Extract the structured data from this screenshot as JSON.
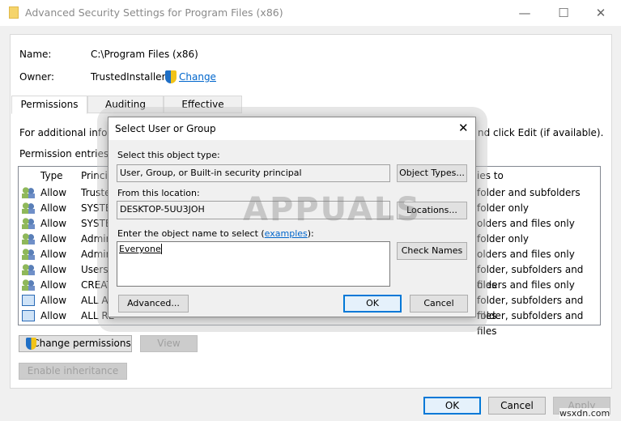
{
  "window": {
    "title": "Advanced Security Settings for Program Files (x86)",
    "minimize": "—",
    "maximize": "☐",
    "close": "✕"
  },
  "info": {
    "name_label": "Name:",
    "name_value": "C:\\Program Files (x86)",
    "owner_label": "Owner:",
    "owner_value": "TrustedInstaller",
    "change_link": "Change"
  },
  "tabs": [
    {
      "label": "Permissions",
      "active": true
    },
    {
      "label": "Auditing"
    },
    {
      "label": "Effective Access"
    }
  ],
  "permissions": {
    "info_text_left": "For additional inform",
    "info_text_right": "nd click Edit (if available).",
    "entries_label": "Permission entries:",
    "columns": {
      "type": "Type",
      "principal": "Princip",
      "applies": "ies to"
    },
    "rows": [
      {
        "icon": "users-icon",
        "type": "Allow",
        "principal": "Truste",
        "applies": "folder and subfolders"
      },
      {
        "icon": "users-icon",
        "type": "Allow",
        "principal": "SYSTE",
        "applies": "folder only"
      },
      {
        "icon": "users-icon",
        "type": "Allow",
        "principal": "SYSTE",
        "applies": "olders and files only"
      },
      {
        "icon": "users-icon",
        "type": "Allow",
        "principal": "Admir",
        "applies": "folder only"
      },
      {
        "icon": "users-icon",
        "type": "Allow",
        "principal": "Admir",
        "applies": "olders and files only"
      },
      {
        "icon": "users-icon",
        "type": "Allow",
        "principal": "Users (",
        "applies": "folder, subfolders and files"
      },
      {
        "icon": "users-icon",
        "type": "Allow",
        "principal": "CREAT",
        "applies": "olders and files only"
      },
      {
        "icon": "app-package-icon",
        "type": "Allow",
        "principal": "ALL Al",
        "applies": "folder, subfolders and files"
      },
      {
        "icon": "app-package-icon",
        "type": "Allow",
        "principal": "ALL RE",
        "applies": "folder, subfolders and files"
      }
    ],
    "change_permissions": "Change permissions",
    "view": "View",
    "enable_inheritance": "Enable inheritance"
  },
  "footer": {
    "ok": "OK",
    "cancel": "Cancel",
    "apply": "Apply"
  },
  "dialog": {
    "title": "Select User or Group",
    "close": "✕",
    "object_type_label": "Select this object type:",
    "object_type_value": "User, Group, or Built-in security principal",
    "object_types_button": "Object Types...",
    "location_label": "From this location:",
    "location_value": "DESKTOP-5UU3JOH",
    "locations_button": "Locations...",
    "name_label_prefix": "Enter the object name to select (",
    "name_label_link": "examples",
    "name_label_suffix": "):",
    "name_value": "Everyone",
    "check_names_button": "Check Names",
    "advanced_button": "Advanced...",
    "ok": "OK",
    "cancel": "Cancel"
  },
  "watermark": {
    "logo": "APPUALS",
    "site": "wsxdn.com"
  },
  "colors": {
    "accent": "#0078d7",
    "link": "#0066cc"
  }
}
